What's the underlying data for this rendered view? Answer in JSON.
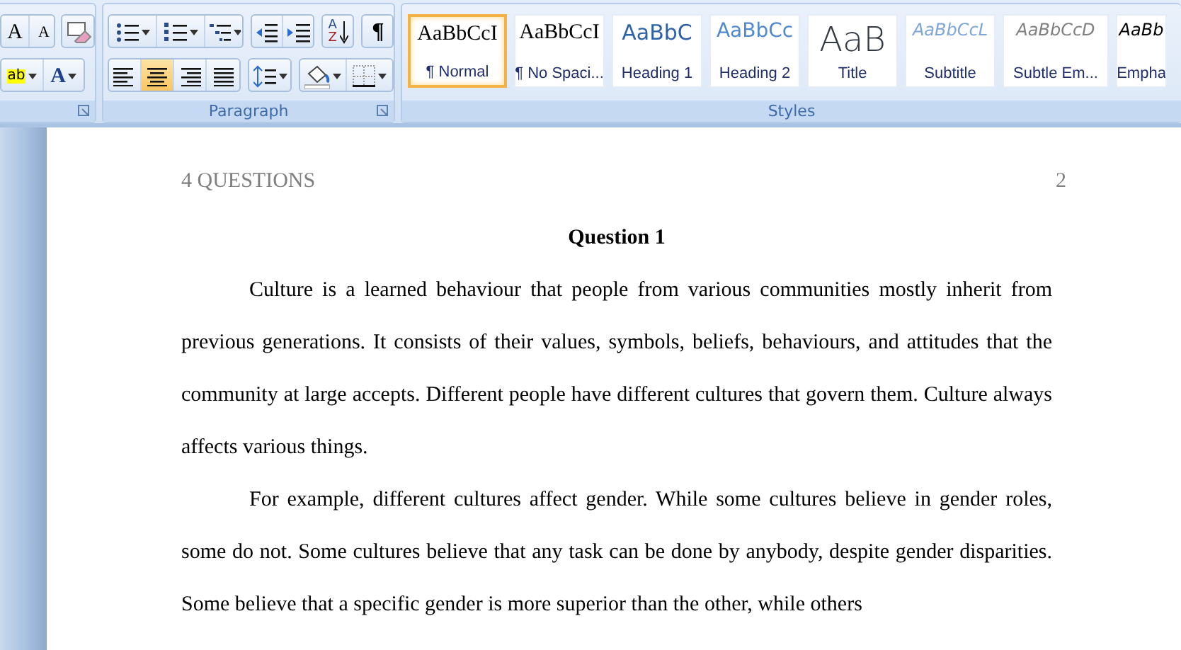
{
  "ribbon": {
    "font_group": {
      "grow_font": "A",
      "shrink_font": "A",
      "highlight": "ab",
      "font_color": "A"
    },
    "paragraph_group": {
      "label": "Paragraph",
      "pilcrow": "¶",
      "sort": {
        "top": "A",
        "bottom": "Z"
      },
      "alignments": [
        {
          "kind": "left",
          "selected": false
        },
        {
          "kind": "center",
          "selected": true
        },
        {
          "kind": "right",
          "selected": false
        },
        {
          "kind": "justify",
          "selected": false
        }
      ]
    },
    "styles_group": {
      "label": "Styles",
      "styles": [
        {
          "kind": "normal",
          "sample": "AaBbCcI",
          "name": "¶ Normal",
          "selected": true
        },
        {
          "kind": "normal",
          "sample": "AaBbCcI",
          "name": "¶ No Spaci...",
          "selected": false
        },
        {
          "kind": "heading1",
          "sample": "AaBbC",
          "name": "Heading 1",
          "selected": false
        },
        {
          "kind": "heading2",
          "sample": "AaBbCc",
          "name": "Heading 2",
          "selected": false
        },
        {
          "kind": "title",
          "sample": "AaB",
          "name": "Title",
          "selected": false
        },
        {
          "kind": "subtitle",
          "sample": "AaBbCcL",
          "name": "Subtitle",
          "selected": false
        },
        {
          "kind": "subtle",
          "sample": "AaBbCcD",
          "name": "Subtle Em...",
          "selected": false
        },
        {
          "kind": "emphasis",
          "sample": "AaBb",
          "name": "Empha",
          "selected": false
        }
      ]
    }
  },
  "document": {
    "header": {
      "title": "4 QUESTIONS",
      "page_number": "2"
    },
    "heading": "Question 1",
    "paragraphs": [
      "Culture is a learned behaviour that people from various communities mostly inherit from previous generations. It consists of their values, symbols, beliefs, behaviours, and attitudes that the community at large accepts. Different people have different cultures that govern them. Culture always affects various things.",
      "For example, different cultures affect gender. While some cultures believe in gender roles, some do not. Some cultures believe that any task can be done by anybody, despite gender disparities. Some believe that a specific gender is more superior than the other, while others"
    ]
  }
}
